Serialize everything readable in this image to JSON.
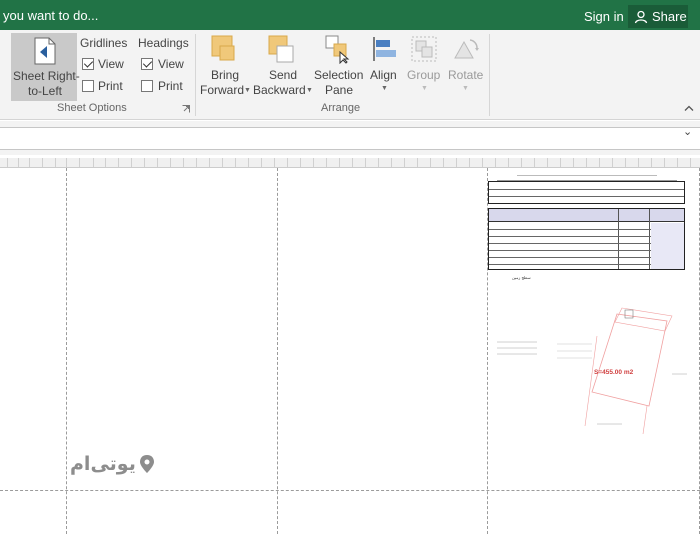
{
  "titlebar": {
    "tell_me": "you want to do...",
    "sign_in": "Sign in",
    "share": "Share"
  },
  "ribbon": {
    "sheet_options": {
      "rtl_line1": "Sheet Right-",
      "rtl_line2": "to-Left",
      "gridlines": "Gridlines",
      "headings": "Headings",
      "view": "View",
      "print": "Print",
      "group_label": "Sheet Options"
    },
    "arrange": {
      "bring_line1": "Bring",
      "bring_line2": "Forward",
      "send_line1": "Send",
      "send_line2": "Backward",
      "selection_line1": "Selection",
      "selection_line2": "Pane",
      "align": "Align",
      "group": "Group",
      "rotate": "Rotate",
      "group_label": "Arrange"
    }
  },
  "watermark": "یوتی‌ام",
  "document": {
    "caption": "سطح زمین",
    "area_label": "S=455.00 m2"
  },
  "colors": {
    "title_green": "#217346",
    "ribbon_bg": "#f3f3f3",
    "area_red": "#d04040"
  }
}
